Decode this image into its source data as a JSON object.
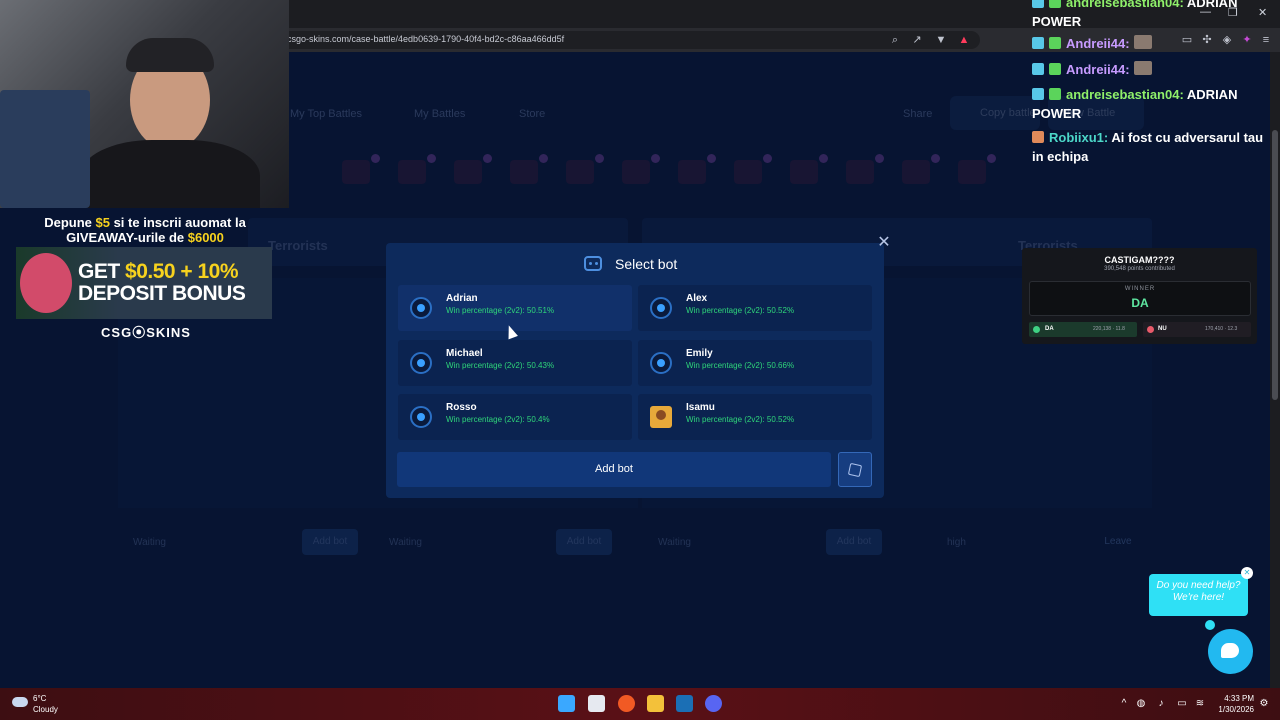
{
  "browser": {
    "url": "csgo-skins.com/case-battle/4edb0639-1790-40f4-bd2c-c86aa466dd5f",
    "controls": {
      "minimize": "—",
      "maximize": "❐",
      "close": "✕"
    }
  },
  "page_bg": {
    "nav": {
      "top_battles": "My Top Battles",
      "my_battles": "My Battles",
      "store": "Store",
      "share": "Share",
      "copy_battle": "Copy battle",
      "new_battle": "New Battle"
    },
    "teams": {
      "left": "Terrorists",
      "right": "Terrorists"
    },
    "slots": {
      "waiting": "Waiting",
      "add_bot": "Add bot",
      "player": "high",
      "leave": "Leave"
    }
  },
  "modal": {
    "title": "Select bot",
    "bots": [
      {
        "name": "Adrian",
        "win": "Win percentage (2v2): 50.51%"
      },
      {
        "name": "Alex",
        "win": "Win percentage (2v2): 50.52%"
      },
      {
        "name": "Michael",
        "win": "Win percentage (2v2): 50.43%"
      },
      {
        "name": "Emily",
        "win": "Win percentage (2v2): 50.66%"
      },
      {
        "name": "Rosso",
        "win": "Win percentage (2v2): 50.4%"
      },
      {
        "name": "Isamu",
        "win": "Win percentage (2v2): 50.52%"
      }
    ],
    "add_bot": "Add bot",
    "close": "✕"
  },
  "promo": {
    "line1_a": "Depune ",
    "line1_amount": "$5",
    "line1_b": " si te inscrii auomat la",
    "line2_a": "GIVEAWAY-urile de ",
    "line2_amount": "$6000",
    "banner_1": "GET ",
    "banner_amount": "$0.50 + 10%",
    "banner_2": "DEPOSIT BONUS",
    "brand": "CSG⦿SKINS"
  },
  "chat": [
    {
      "user": "andreisebastian04:",
      "msg": " ADRIAN POWER",
      "color": "green"
    },
    {
      "user": "Andreii44:",
      "msg": "",
      "color": "purple"
    },
    {
      "user": "Andreii44:",
      "msg": "",
      "color": "purple"
    },
    {
      "user": "andreisebastian04:",
      "msg": " ADRIAN POWER",
      "color": "green"
    },
    {
      "user": "Robiixu1:",
      "msg": " Ai fost cu adversarul tau in echipa",
      "color": "teal"
    }
  ],
  "poll": {
    "title": "CASTIGAM????",
    "sub": "390,548 points contributed",
    "winner_label": "WINNER",
    "winner": "DA",
    "opt1": {
      "name": "DA",
      "val": "220,138 · 11.8"
    },
    "opt2": {
      "name": "NU",
      "val": "170,410 · 12.3"
    }
  },
  "help": {
    "line1": "Do you need help?",
    "line2": "We're here!"
  },
  "taskbar": {
    "temp": "6°C",
    "weather": "Cloudy",
    "time": "4:33 PM",
    "date": "1/30/2026"
  },
  "colors": {
    "accent": "#2fd67a",
    "modal_bg": "#0d2a5c",
    "page_bg": "#0b1d44"
  }
}
